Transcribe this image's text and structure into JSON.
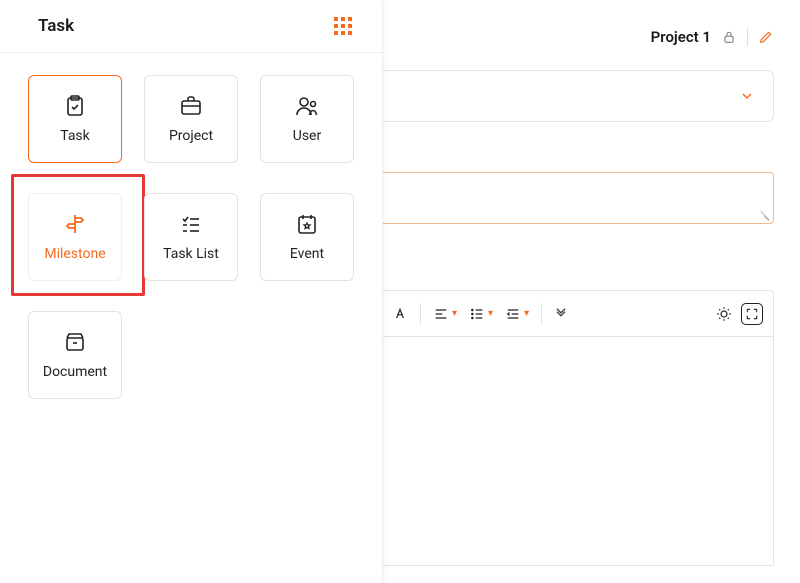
{
  "picker": {
    "title": "Task",
    "tiles": [
      {
        "label": "Task",
        "icon": "clipboard-check-icon",
        "selected": true,
        "highlighted": false
      },
      {
        "label": "Project",
        "icon": "briefcase-icon",
        "selected": false,
        "highlighted": false
      },
      {
        "label": "User",
        "icon": "user-icon",
        "selected": false,
        "highlighted": false
      },
      {
        "label": "Milestone",
        "icon": "signpost-icon",
        "selected": false,
        "highlighted": true
      },
      {
        "label": "Task List",
        "icon": "checklist-icon",
        "selected": false,
        "highlighted": false
      },
      {
        "label": "Event",
        "icon": "calendar-star-icon",
        "selected": false,
        "highlighted": false
      },
      {
        "label": "Document",
        "icon": "box-icon",
        "selected": false,
        "highlighted": false
      }
    ]
  },
  "main": {
    "project_name": "Project 1"
  },
  "colors": {
    "accent": "#f56a1d",
    "highlight_red": "#e53935"
  }
}
